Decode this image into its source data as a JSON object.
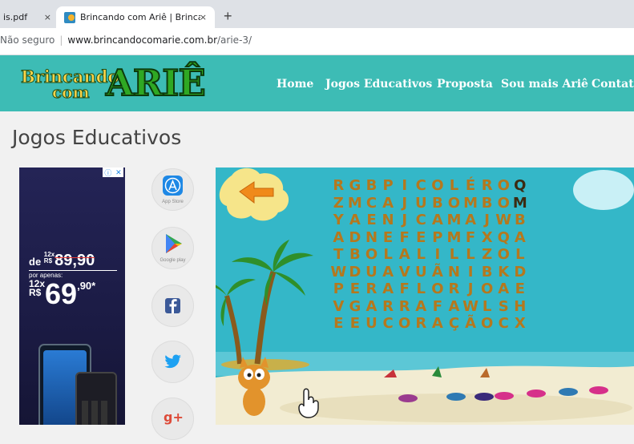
{
  "browser": {
    "tabs": [
      {
        "title": "is.pdf",
        "close": "×"
      },
      {
        "title": "Brincando com Ariê | Brincando c",
        "close": "×"
      }
    ],
    "new_tab": "+",
    "address": {
      "security": "Não seguro",
      "host": "www.brincandocomarie.com.br",
      "path": "/arie-3/"
    }
  },
  "site": {
    "logo": {
      "line1": "Brincando",
      "line2": "com",
      "word": "ARIÊ"
    },
    "nav": [
      "Home",
      "Jogos Educativos",
      "Proposta",
      "Sou mais Ariê",
      "Contato"
    ]
  },
  "page": {
    "title": "Jogos Educativos"
  },
  "ad": {
    "prefix": "de",
    "old_installments": "12x",
    "old_currency": "R$",
    "old_price": "89,90",
    "apenas": "por apenas:",
    "new_installments": "12x",
    "new_currency": "R$",
    "new_price_int": "69",
    "new_price_cents": ",90*"
  },
  "social": [
    {
      "icon": "app-store-icon",
      "label": "App Store",
      "color": "#1e88e5"
    },
    {
      "icon": "google-play-icon",
      "label": "Google play",
      "color": "#34a853"
    },
    {
      "icon": "facebook-icon",
      "label": "",
      "color": "#3b5998"
    },
    {
      "icon": "twitter-icon",
      "label": "",
      "color": "#1da1f2"
    },
    {
      "icon": "google-plus-icon",
      "label": "",
      "color": "#dd4b39"
    }
  ],
  "game": {
    "grid": [
      [
        "R",
        "G",
        "B",
        "P",
        "I",
        "C",
        "O",
        "L",
        "É",
        "R",
        "O",
        "Q"
      ],
      [
        "Z",
        "M",
        "C",
        "A",
        "J",
        "U",
        "B",
        "O",
        "M",
        "B",
        "O",
        "M"
      ],
      [
        "Y",
        "A",
        "E",
        "N",
        "J",
        "C",
        "A",
        "M",
        "A",
        "J",
        "W",
        "B"
      ],
      [
        "A",
        "D",
        "N",
        "E",
        "F",
        "E",
        "P",
        "M",
        "F",
        "X",
        "Q",
        "A"
      ],
      [
        "T",
        "B",
        "O",
        "L",
        "A",
        "L",
        "I",
        "L",
        "L",
        "Z",
        "O",
        "L"
      ],
      [
        "W",
        "D",
        "U",
        "A",
        "V",
        "U",
        "Ã",
        "N",
        "I",
        "B",
        "K",
        "D"
      ],
      [
        "P",
        "E",
        "R",
        "A",
        "F",
        "L",
        "O",
        "R",
        "J",
        "O",
        "A",
        "E"
      ],
      [
        "V",
        "G",
        "A",
        "R",
        "R",
        "A",
        "F",
        "A",
        "W",
        "L",
        "S",
        "H"
      ],
      [
        "E",
        "E",
        "U",
        "C",
        "O",
        "R",
        "A",
        "Ç",
        "Ã",
        "O",
        "C",
        "X"
      ]
    ],
    "colors": {
      "sky": "#34b7c8",
      "letter": "#b5781d",
      "sand": "#f2ecd2",
      "header": "#3dbcb5"
    }
  }
}
